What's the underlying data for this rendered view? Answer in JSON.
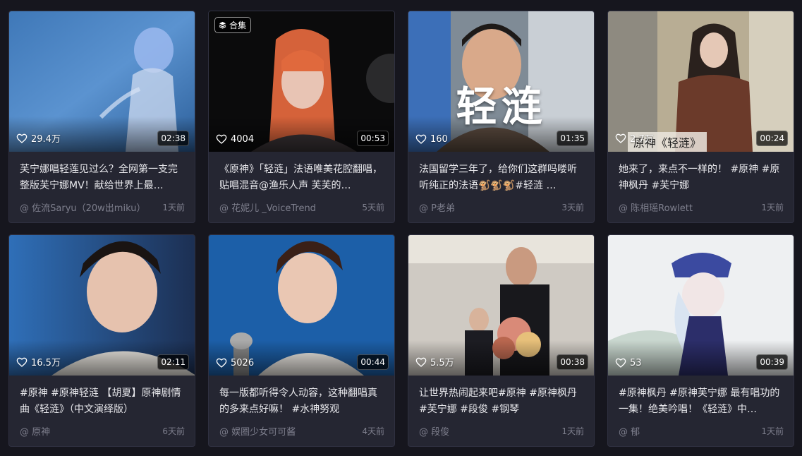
{
  "cards": [
    {
      "likes": "29.4万",
      "duration": "02:38",
      "title": "芙宁娜唱轻莲见过么？全网第一支完整版芙宁娜MV！献给世界上最…",
      "author": "@ 佐流Saryu（20w出miku）",
      "time": "1天前"
    },
    {
      "badge": "合集",
      "likes": "4004",
      "duration": "00:53",
      "title": "《原神》「轻涟」法语唯美花腔翻唱，贴唱混音@渔乐人声 芙芙的…",
      "author": "@ 花妮儿 _VoiceTrend",
      "time": "5天前"
    },
    {
      "overlay": "轻涟",
      "likes": "160",
      "duration": "01:35",
      "title": "法国留学三年了，给你们这群吗喽听听纯正的法语🐒🐒🐒#轻涟 …",
      "author": "@ P老弟",
      "time": "3天前"
    },
    {
      "caption": "原神《轻涟》",
      "likes": "2.7万",
      "duration": "00:24",
      "title": "她来了，来点不一样的！ #原神 #原神枫丹 #芙宁娜",
      "author": "@ 陈相瑶Rowlett",
      "time": "1天前"
    },
    {
      "likes": "16.5万",
      "duration": "02:11",
      "title": "#原神 #原神轻涟 【胡夏】原神剧情曲《轻涟》（中文演绎版）",
      "author": "@ 原神",
      "time": "6天前"
    },
    {
      "likes": "5026",
      "duration": "00:44",
      "title": "每一版都听得令人动容，这种翻唱真的多来点好嘛！ #水神努观",
      "author": "@ 娱圈少女可可酱",
      "time": "4天前"
    },
    {
      "likes": "5.5万",
      "duration": "00:38",
      "title": "让世界热闹起来吧#原神 #原神枫丹 #芙宁娜 #段俊 #钢琴",
      "author": "@ 段俊",
      "time": "1天前"
    },
    {
      "likes": "53",
      "duration": "00:39",
      "title": "#原神枫丹 #原神芙宁娜 最有唱功的一集！绝美吟唱！《轻涟》中…",
      "author": "@ 郁",
      "time": "1天前"
    }
  ],
  "icons": {
    "like": "heart-icon",
    "collection": "layers-icon"
  }
}
